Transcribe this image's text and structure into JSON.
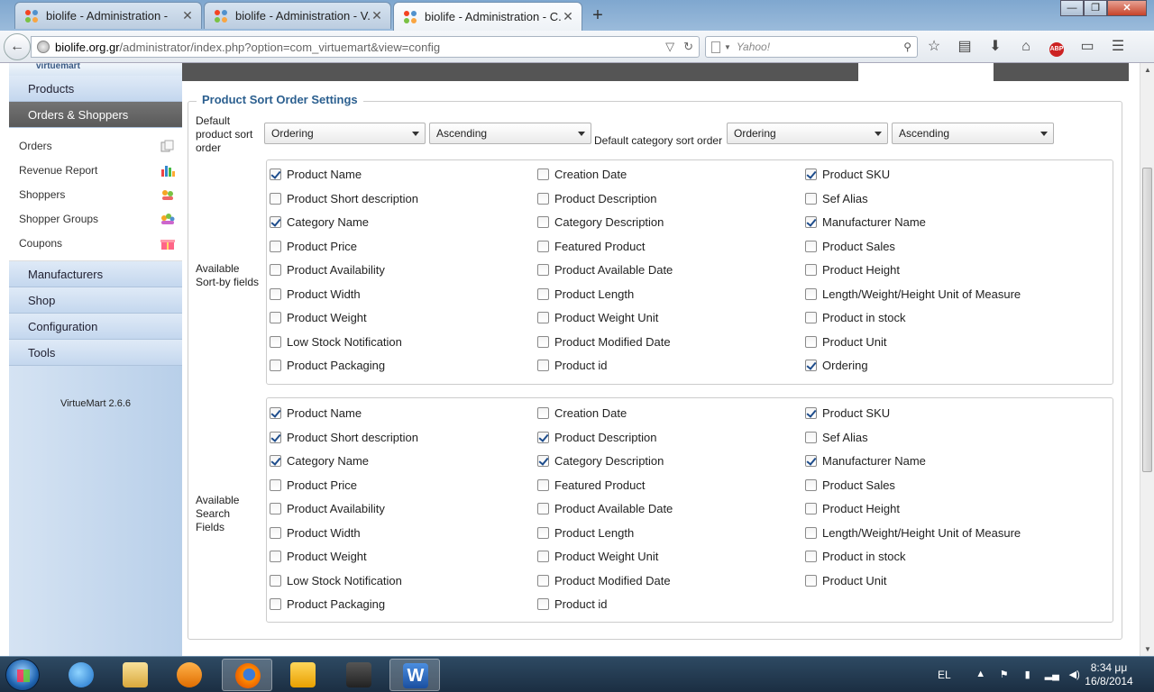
{
  "browser": {
    "tabs": [
      {
        "title": "biolife - Administration -",
        "active": false
      },
      {
        "title": "biolife - Administration - V...",
        "active": false
      },
      {
        "title": "biolife - Administration - C...",
        "active": true
      }
    ],
    "url_host": "biolife.org.gr",
    "url_path": "/administrator/index.php?option=com_virtuemart&view=config",
    "search_placeholder": "Yahoo!",
    "window_controls": {
      "minimize": "—",
      "maximize": "❐",
      "close": "✕"
    }
  },
  "sidebar": {
    "logo_text": "virtuemart",
    "items": [
      {
        "label": "Products",
        "active": false
      },
      {
        "label": "Orders & Shoppers",
        "active": true
      }
    ],
    "subitems": [
      {
        "label": "Orders",
        "icon": "orders-icon"
      },
      {
        "label": "Revenue Report",
        "icon": "chart-icon"
      },
      {
        "label": "Shoppers",
        "icon": "shoppers-icon"
      },
      {
        "label": "Shopper Groups",
        "icon": "shopper-groups-icon"
      },
      {
        "label": "Coupons",
        "icon": "gift-icon"
      }
    ],
    "items_after": [
      {
        "label": "Manufacturers"
      },
      {
        "label": "Shop"
      },
      {
        "label": "Configuration"
      },
      {
        "label": "Tools"
      }
    ],
    "version": "VirtueMart 2.6.6"
  },
  "settings": {
    "legend": "Product Sort Order Settings",
    "default_product_label": "Default product sort order",
    "default_product_field": "Ordering",
    "default_product_dir": "Ascending",
    "default_category_label": "Default category sort order",
    "default_category_field": "Ordering",
    "default_category_dir": "Ascending",
    "sortby_label": "Available Sort-by fields",
    "search_label": "Available Search Fields",
    "sortby_fields": [
      {
        "label": "Product Name",
        "checked": true
      },
      {
        "label": "Creation Date",
        "checked": false
      },
      {
        "label": "Product SKU",
        "checked": true
      },
      {
        "label": "Product Short description",
        "checked": false
      },
      {
        "label": "Product Description",
        "checked": false
      },
      {
        "label": "Sef Alias",
        "checked": false
      },
      {
        "label": "Category Name",
        "checked": true
      },
      {
        "label": "Category Description",
        "checked": false
      },
      {
        "label": "Manufacturer Name",
        "checked": true
      },
      {
        "label": "Product Price",
        "checked": false
      },
      {
        "label": "Featured Product",
        "checked": false
      },
      {
        "label": "Product Sales",
        "checked": false
      },
      {
        "label": "Product Availability",
        "checked": false
      },
      {
        "label": "Product Available Date",
        "checked": false
      },
      {
        "label": "Product Height",
        "checked": false
      },
      {
        "label": "Product Width",
        "checked": false
      },
      {
        "label": "Product Length",
        "checked": false
      },
      {
        "label": "Length/Weight/Height Unit of Measure",
        "checked": false
      },
      {
        "label": "Product Weight",
        "checked": false
      },
      {
        "label": "Product Weight Unit",
        "checked": false
      },
      {
        "label": "Product in stock",
        "checked": false
      },
      {
        "label": "Low Stock Notification",
        "checked": false
      },
      {
        "label": "Product Modified Date",
        "checked": false
      },
      {
        "label": "Product Unit",
        "checked": false
      },
      {
        "label": "Product Packaging",
        "checked": false
      },
      {
        "label": "Product id",
        "checked": false
      },
      {
        "label": "Ordering",
        "checked": true
      }
    ],
    "search_fields": [
      {
        "label": "Product Name",
        "checked": true
      },
      {
        "label": "Creation Date",
        "checked": false
      },
      {
        "label": "Product SKU",
        "checked": true
      },
      {
        "label": "Product Short description",
        "checked": true
      },
      {
        "label": "Product Description",
        "checked": true
      },
      {
        "label": "Sef Alias",
        "checked": false
      },
      {
        "label": "Category Name",
        "checked": true
      },
      {
        "label": "Category Description",
        "checked": true
      },
      {
        "label": "Manufacturer Name",
        "checked": true
      },
      {
        "label": "Product Price",
        "checked": false
      },
      {
        "label": "Featured Product",
        "checked": false
      },
      {
        "label": "Product Sales",
        "checked": false
      },
      {
        "label": "Product Availability",
        "checked": false
      },
      {
        "label": "Product Available Date",
        "checked": false
      },
      {
        "label": "Product Height",
        "checked": false
      },
      {
        "label": "Product Width",
        "checked": false
      },
      {
        "label": "Product Length",
        "checked": false
      },
      {
        "label": "Length/Weight/Height Unit of Measure",
        "checked": false
      },
      {
        "label": "Product Weight",
        "checked": false
      },
      {
        "label": "Product Weight Unit",
        "checked": false
      },
      {
        "label": "Product in stock",
        "checked": false
      },
      {
        "label": "Low Stock Notification",
        "checked": false
      },
      {
        "label": "Product Modified Date",
        "checked": false
      },
      {
        "label": "Product Unit",
        "checked": false
      },
      {
        "label": "Product Packaging",
        "checked": false
      },
      {
        "label": "Product id",
        "checked": false
      }
    ]
  },
  "taskbar": {
    "apps": [
      "internet-explorer",
      "file-explorer",
      "media-player",
      "firefox",
      "outlook",
      "movie-maker",
      "word"
    ],
    "language": "EL",
    "time": "8:34 μμ",
    "date": "16/8/2014"
  }
}
